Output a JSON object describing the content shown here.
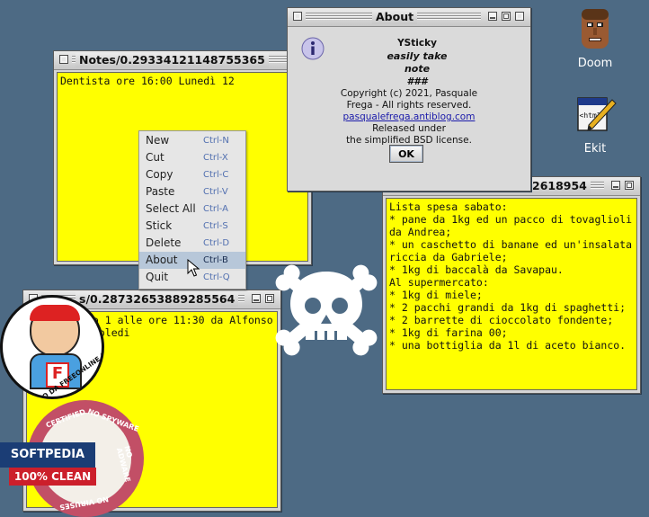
{
  "desktop": {
    "icons": [
      {
        "label": "Doom"
      },
      {
        "label": "Ekit"
      }
    ]
  },
  "note1": {
    "title": "Notes/0.29334121148755365",
    "text": "Dentista ore 16:00 Lunedì 12"
  },
  "note2": {
    "title": "Notes/0.28732653889285564",
    "title_visible": "s/0.28732653889285564",
    "text": "to 1 alle ore 11:30 da Alfonso\nrcoledi"
  },
  "note3": {
    "title_visible": "2618954",
    "text": "Lista spesa sabato:\n* pane da 1kg ed un pacco di tovaglioli da Andrea;\n* un caschetto di banane ed un'insalata riccia da Gabriele;\n* 1kg di baccalà da Savapau.\nAl supermercato:\n* 1kg di miele;\n* 2 pacchi grandi da 1kg di spaghetti;\n* 2 barrette di cioccolato fondente;\n* 1kg di farina 00;\n* una bottiglia da 1l di aceto bianco."
  },
  "context_menu": {
    "items": [
      {
        "label": "New",
        "shortcut": "Ctrl-N"
      },
      {
        "label": "Cut",
        "shortcut": "Ctrl-X"
      },
      {
        "label": "Copy",
        "shortcut": "Ctrl-C"
      },
      {
        "label": "Paste",
        "shortcut": "Ctrl-V"
      },
      {
        "label": "Select All",
        "shortcut": "Ctrl-A"
      },
      {
        "label": "Stick",
        "shortcut": "Ctrl-S"
      },
      {
        "label": "Delete",
        "shortcut": "Ctrl-D"
      },
      {
        "label": "About",
        "shortcut": "Ctrl-B"
      },
      {
        "label": "Quit",
        "shortcut": "Ctrl-Q"
      }
    ],
    "selected": "About"
  },
  "about": {
    "title": "About",
    "app_name": "YSticky",
    "tagline1": "easily take",
    "tagline2": "note",
    "separator": "###",
    "copyright1": "Copyright (c) 2021, Pasquale",
    "copyright2": "Frega - All rights reserved.",
    "link": "pasqualefrega.antiblog.com",
    "license1": "Released under",
    "license2": "the simplified BSD license.",
    "ok_label": "OK"
  },
  "badges": {
    "softpedia": "SOFTPEDIA",
    "clean": "100% CLEAN",
    "certified": "CERTIFIED",
    "no_spyware": "NO SPYWARE",
    "no_adware": "NO ADWARE",
    "no_viruses": "NO VIRUSES",
    "freeonline": "CONSIGLIATO DA FREEONLINE.IT",
    "freeonline_letter": "F"
  },
  "colors": {
    "desktop_bg": "#4d6a84",
    "note_bg": "#ffff00",
    "link": "#1a1aaa",
    "menu_selected": "#b7c7d9"
  }
}
